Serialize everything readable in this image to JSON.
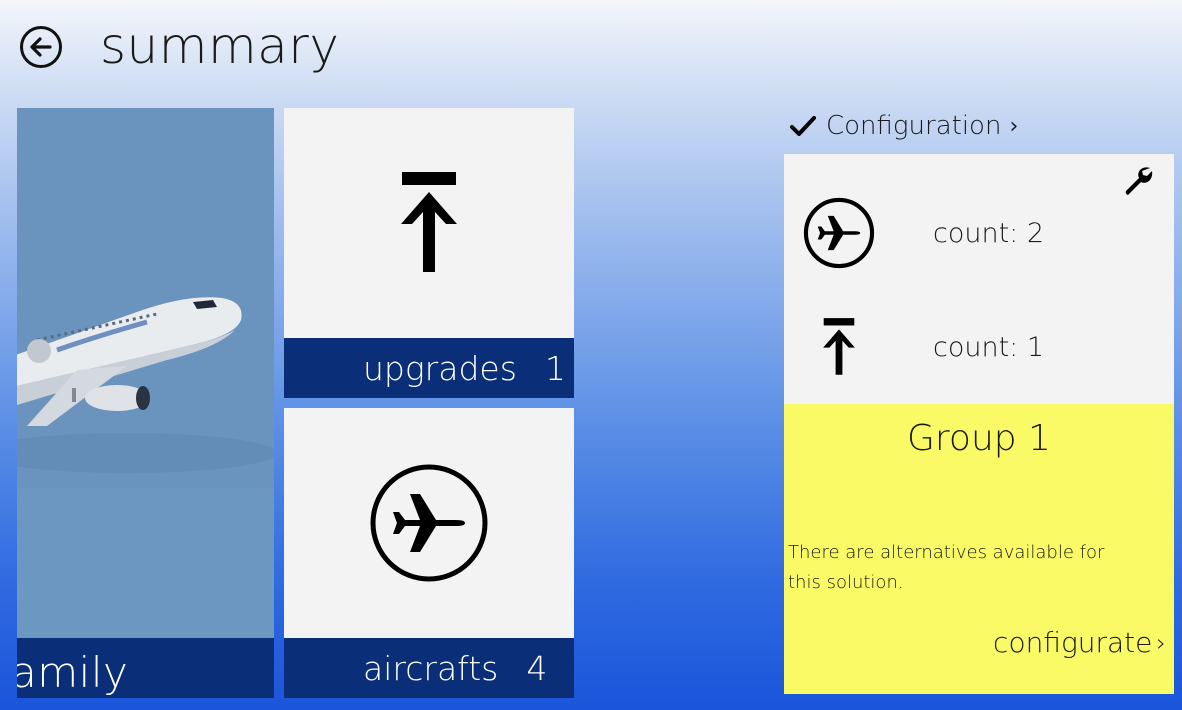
{
  "header": {
    "title": "summary",
    "back_icon": "back-arrow-icon"
  },
  "tiles": {
    "family": {
      "label": "amily",
      "image": "airplane-photo"
    },
    "upgrades": {
      "label": "upgrades",
      "count": "1",
      "icon": "upload-arrow-icon"
    },
    "aircrafts": {
      "label": "aircrafts",
      "count": "4",
      "icon": "airplane-circle-icon"
    }
  },
  "configuration": {
    "header_label": "Configuration",
    "header_chevron": "›",
    "check_icon": "checkmark-icon",
    "settings_icon": "wrench-icon",
    "rows": [
      {
        "icon": "airplane-circle-icon",
        "text": "count: 2"
      },
      {
        "icon": "upload-arrow-icon",
        "text": "count: 1"
      }
    ]
  },
  "group": {
    "title": "Group 1",
    "description": "There are alternatives available for this solution.",
    "action_label": "configurate",
    "action_chevron": "›"
  },
  "colors": {
    "tile_label_bar": "#0a2f78",
    "tile_bg": "#f3f3f3",
    "group_bg": "#fafa66",
    "photo_bg": "#6b95bf"
  }
}
